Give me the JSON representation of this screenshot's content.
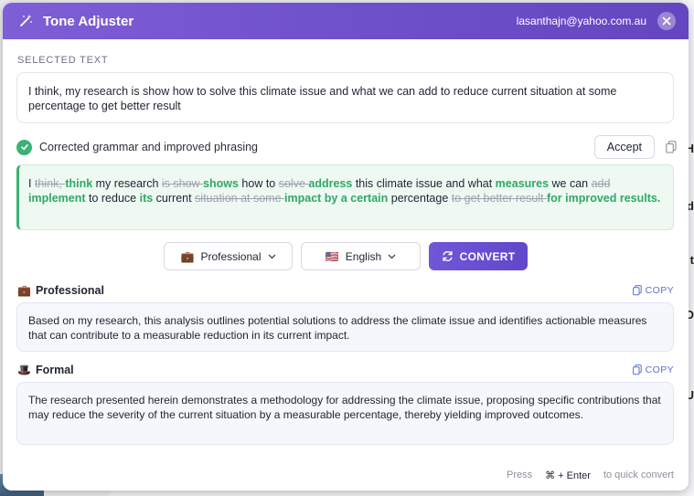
{
  "header": {
    "title": "Tone Adjuster",
    "email": "lasanthajn@yahoo.com.au"
  },
  "selected": {
    "label": "SELECTED TEXT",
    "text": "I think, my research is show how to solve this climate issue and what we can add to reduce current situation at some percentage to get better result"
  },
  "correction": {
    "status": "Corrected grammar and improved phrasing",
    "accept_label": "Accept",
    "segments": [
      {
        "t": "I ",
        "k": "n"
      },
      {
        "t": "think, ",
        "k": "d"
      },
      {
        "t": "think",
        "k": "i"
      },
      {
        "t": " my research ",
        "k": "n"
      },
      {
        "t": "is show ",
        "k": "d"
      },
      {
        "t": "shows",
        "k": "i"
      },
      {
        "t": " how to ",
        "k": "n"
      },
      {
        "t": "solve ",
        "k": "d"
      },
      {
        "t": "address",
        "k": "i"
      },
      {
        "t": " this climate issue and what ",
        "k": "n"
      },
      {
        "t": "measures",
        "k": "i"
      },
      {
        "t": " we can ",
        "k": "n"
      },
      {
        "t": "add",
        "k": "d"
      },
      {
        "t": " ",
        "k": "n"
      },
      {
        "t": "implement",
        "k": "i"
      },
      {
        "t": " to reduce ",
        "k": "n"
      },
      {
        "t": "its",
        "k": "i"
      },
      {
        "t": " current ",
        "k": "n"
      },
      {
        "t": "situation at some ",
        "k": "d"
      },
      {
        "t": "impact by a certain",
        "k": "i"
      },
      {
        "t": " percentage ",
        "k": "n"
      },
      {
        "t": "to get better result ",
        "k": "d"
      },
      {
        "t": "for improved results.",
        "k": "i"
      }
    ]
  },
  "controls": {
    "tone_icon": "💼",
    "tone": "Professional",
    "lang_icon": "🇺🇸",
    "language": "English",
    "convert_label": "CONVERT"
  },
  "results": [
    {
      "icon": "💼",
      "title": "Professional",
      "copy_label": "COPY",
      "text": "Based on my research, this analysis outlines potential solutions to address the climate issue and identifies actionable measures that can contribute to a measurable reduction in its current impact."
    },
    {
      "icon": "🎩",
      "title": "Formal",
      "copy_label": "COPY",
      "text": "The research presented herein demonstrates a methodology for addressing the climate issue, proposing specific contributions that may reduce the severity of the current situation by a measurable percentage, thereby yielding improved outcomes."
    }
  ],
  "footer": {
    "press": "Press",
    "shortcut": "⌘ + Enter",
    "hint": "to quick convert"
  },
  "background": {
    "glyphs": [
      "H",
      "d",
      "t",
      "D",
      "U"
    ]
  },
  "colors": {
    "accent": "#6e58d8",
    "success": "#3bb273",
    "link": "#5b6fd6"
  }
}
